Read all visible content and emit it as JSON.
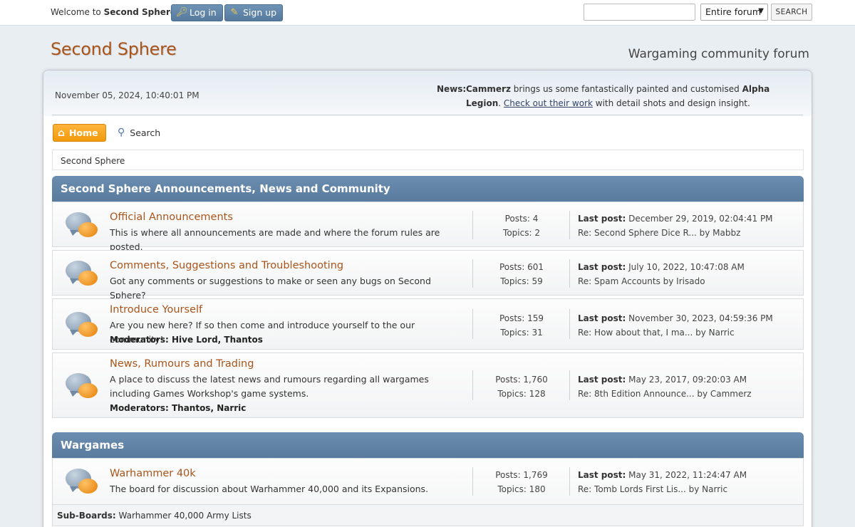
{
  "topbar": {
    "welcome_prefix": "Welcome to ",
    "welcome_site": "Second Sphere",
    "welcome_suffix": ".",
    "login_label": "Log in",
    "signup_label": "Sign up",
    "search_value": "",
    "scope_selected": "Entire forum",
    "search_button": "SEARCH"
  },
  "header": {
    "forum_title": "Second Sphere",
    "slogan": "Wargaming community forum"
  },
  "upper": {
    "datetime": "November 05, 2024, 10:40:01 PM",
    "news_label": "News:",
    "news_author": "Cammerz",
    "news_mid": " brings us some fantastically painted and customised ",
    "news_bold": "Alpha Legion",
    "news_dot": ". ",
    "news_link": "Check out their work",
    "news_tail": " with detail shots and design insight."
  },
  "menu": {
    "home": "Home",
    "search": "Search"
  },
  "breadcrumb": "Second Sphere",
  "categories": [
    {
      "title": "Second Sphere Announcements, News and Community",
      "boards": [
        {
          "name": "Official Announcements",
          "desc": "This is where all announcements are made and where the forum rules are posted.",
          "mods_label": "",
          "mods": "",
          "posts": "Posts: 4",
          "topics": "Topics: 2",
          "last_label": "Last post:",
          "last_date": " December 29, 2019, 02:04:41 PM",
          "last_topic": "Re: Second Sphere Dice R... by Mabbz"
        },
        {
          "name": "Comments, Suggestions and Troubleshooting",
          "desc": "Got any comments or suggestions to make or seen any bugs on Second Sphere?",
          "mods_label": "",
          "mods": "",
          "posts": "Posts: 601",
          "topics": "Topics: 59",
          "last_label": "Last post:",
          "last_date": " July 10, 2022, 10:47:08 AM",
          "last_topic": "Re: Spam Accounts by Irisado"
        },
        {
          "name": "Introduce Yourself",
          "desc": "Are you new here? If so then come and introduce yourself to the our community!",
          "mods_label": "Moderators:",
          "mods": " Hive Lord, Thantos",
          "posts": "Posts: 159",
          "topics": "Topics: 31",
          "last_label": "Last post:",
          "last_date": " November 30, 2023, 04:59:36 PM",
          "last_topic": "Re: How about that, I ma... by Narric"
        },
        {
          "name": "News, Rumours and Trading",
          "desc": "A place to discuss the latest news and rumours regarding all wargames including Games Workshop's game systems.",
          "mods_label": "Moderators:",
          "mods": " Thantos, Narric",
          "posts": "Posts: 1,760",
          "topics": "Topics: 128",
          "last_label": "Last post:",
          "last_date": " May 23, 2017, 09:20:03 AM",
          "last_topic": "Re: 8th Edition Announce... by Cammerz"
        }
      ]
    },
    {
      "title": "Wargames",
      "boards": [
        {
          "name": "Warhammer 40k",
          "desc": "The board for discussion about Warhammer 40,000 and its Expansions.",
          "mods_label": "",
          "mods": "",
          "posts": "Posts: 1,769",
          "topics": "Topics: 180",
          "last_label": "Last post:",
          "last_date": " May 31, 2022, 11:24:47 AM",
          "last_topic": "Re: Tomb Lords First Lis... by Narric",
          "subboards_label": "Sub-Boards:",
          "subboards": " Warhammer 40,000 Army Lists"
        }
      ]
    }
  ],
  "icons": {
    "login": "key-icon",
    "signup": "pencil-icon",
    "home": "house-icon",
    "search": "magnifier-icon",
    "board": "speech-bubbles-icon"
  },
  "colors": {
    "accent_orange": "#f29a0c",
    "title_brown": "#a9541a",
    "category_blue": "#6a8db0"
  }
}
